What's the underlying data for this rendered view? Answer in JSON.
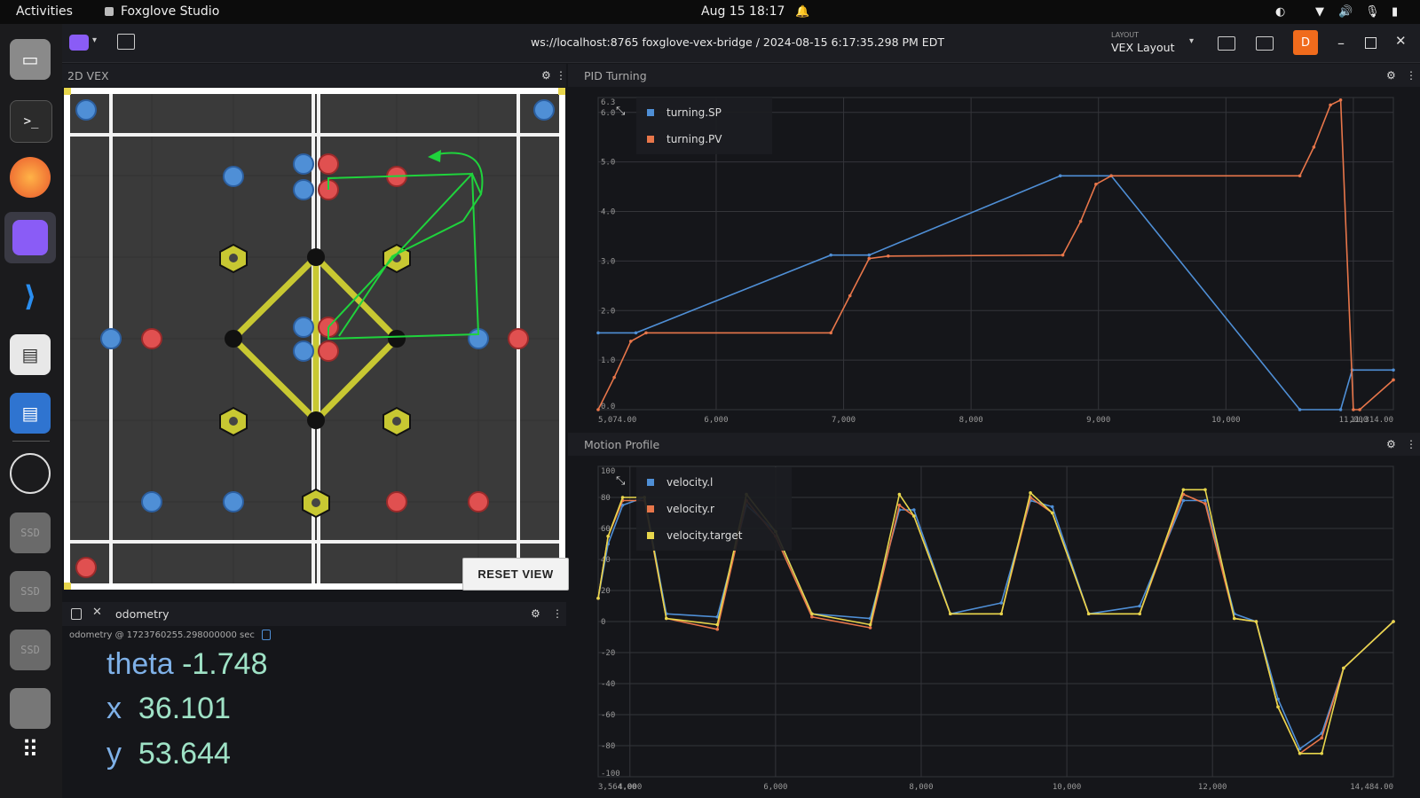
{
  "topbar": {
    "activities": "Activities",
    "app_name": "Foxglove Studio",
    "datetime": "Aug 15  18:17"
  },
  "toolbar": {
    "connection": "ws://localhost:8765 foxglove-vex-bridge / 2024-08-15 6:17:35.298 PM EDT",
    "layout_caption": "LAYOUT",
    "layout_name": "VEX Layout",
    "user_initial": "D"
  },
  "dock": {
    "ssd_label": "SSD"
  },
  "panels": {
    "map": {
      "title": "2D VEX",
      "reset_label": "RESET VIEW"
    },
    "odometry": {
      "tab_label": "odometry",
      "message_meta": "odometry @ 1723760255.298000000 sec",
      "fields": [
        {
          "key": "theta",
          "value": "-1.748"
        },
        {
          "key": "x",
          "value": "36.101"
        },
        {
          "key": "y",
          "value": "53.644"
        }
      ]
    },
    "pid": {
      "title": "PID Turning"
    },
    "motion": {
      "title": "Motion Profile"
    }
  },
  "colors": {
    "blue": "#4f8fd6",
    "orange": "#e8764a",
    "yellow": "#e7d64c",
    "green": "#1fd33c",
    "field_yellow": "#c8c832"
  },
  "chart_data": [
    {
      "type": "line",
      "title": "PID Turning",
      "xlim": [
        5074,
        11314
      ],
      "ylim": [
        0,
        6.3
      ],
      "x_ticks": [
        "5,074.00",
        "6,000",
        "7,000",
        "8,000",
        "9,000",
        "10,000",
        "11,000",
        "11,314.00"
      ],
      "y_ticks": [
        "0.0",
        "1.0",
        "2.0",
        "3.0",
        "4.0",
        "5.0",
        "6.0",
        "6.3"
      ],
      "series": [
        {
          "name": "turning.SP",
          "color": "#4f8fd6",
          "points": [
            [
              5074,
              1.55
            ],
            [
              5370,
              1.55
            ],
            [
              6900,
              3.12
            ],
            [
              7200,
              3.12
            ],
            [
              8700,
              4.72
            ],
            [
              9100,
              4.72
            ],
            [
              10580,
              0
            ],
            [
              10900,
              0
            ],
            [
              10990,
              0.8
            ],
            [
              11314,
              0.8
            ]
          ]
        },
        {
          "name": "turning.PV",
          "color": "#e8764a",
          "points": [
            [
              5074,
              0
            ],
            [
              5200,
              0.65
            ],
            [
              5330,
              1.38
            ],
            [
              5450,
              1.55
            ],
            [
              6900,
              1.55
            ],
            [
              7050,
              2.3
            ],
            [
              7200,
              3.05
            ],
            [
              7350,
              3.1
            ],
            [
              8720,
              3.12
            ],
            [
              8860,
              3.8
            ],
            [
              8980,
              4.55
            ],
            [
              9100,
              4.72
            ],
            [
              10580,
              4.72
            ],
            [
              10690,
              5.3
            ],
            [
              10820,
              6.15
            ],
            [
              10900,
              6.25
            ],
            [
              11000,
              0
            ],
            [
              11050,
              0
            ],
            [
              11314,
              0.6
            ]
          ]
        }
      ]
    },
    {
      "type": "line",
      "title": "Motion Profile",
      "xlim": [
        3564,
        14484
      ],
      "ylim": [
        -100,
        100
      ],
      "x_ticks": [
        "3,564.00",
        "4,000",
        "6,000",
        "8,000",
        "10,000",
        "12,000",
        "14,484.00"
      ],
      "y_ticks": [
        "100",
        "80",
        "60",
        "40",
        "20",
        "0",
        "-20",
        "-40",
        "-60",
        "-80",
        "-100"
      ],
      "series": [
        {
          "name": "velocity.l",
          "color": "#4f8fd6",
          "points": [
            [
              3564,
              15
            ],
            [
              3700,
              50
            ],
            [
              3900,
              75
            ],
            [
              4200,
              80
            ],
            [
              4500,
              5
            ],
            [
              5200,
              3
            ],
            [
              5600,
              75
            ],
            [
              6000,
              58
            ],
            [
              6500,
              5
            ],
            [
              7300,
              2
            ],
            [
              7700,
              72
            ],
            [
              7900,
              72
            ],
            [
              8400,
              5
            ],
            [
              9100,
              12
            ],
            [
              9500,
              78
            ],
            [
              9800,
              74
            ],
            [
              10300,
              5
            ],
            [
              11000,
              10
            ],
            [
              11600,
              78
            ],
            [
              11900,
              78
            ],
            [
              12300,
              5
            ],
            [
              12600,
              0
            ],
            [
              12900,
              -50
            ],
            [
              13200,
              -82
            ],
            [
              13500,
              -72
            ],
            [
              13800,
              -30
            ],
            [
              14484,
              0
            ]
          ]
        },
        {
          "name": "velocity.r",
          "color": "#e8764a",
          "points": [
            [
              3564,
              15
            ],
            [
              3700,
              55
            ],
            [
              3900,
              78
            ],
            [
              4200,
              78
            ],
            [
              4500,
              2
            ],
            [
              5200,
              -5
            ],
            [
              5600,
              78
            ],
            [
              6000,
              55
            ],
            [
              6500,
              3
            ],
            [
              7300,
              -4
            ],
            [
              7700,
              75
            ],
            [
              7900,
              68
            ],
            [
              8400,
              5
            ],
            [
              9100,
              5
            ],
            [
              9500,
              80
            ],
            [
              9800,
              70
            ],
            [
              10300,
              5
            ],
            [
              11000,
              5
            ],
            [
              11600,
              82
            ],
            [
              11900,
              76
            ],
            [
              12300,
              2
            ],
            [
              12600,
              0
            ],
            [
              12900,
              -55
            ],
            [
              13200,
              -85
            ],
            [
              13500,
              -75
            ],
            [
              13800,
              -30
            ],
            [
              14484,
              0
            ]
          ]
        },
        {
          "name": "velocity.target",
          "color": "#e7d64c",
          "points": [
            [
              3564,
              15
            ],
            [
              3700,
              55
            ],
            [
              3900,
              80
            ],
            [
              4200,
              80
            ],
            [
              4500,
              2
            ],
            [
              5200,
              -2
            ],
            [
              5600,
              82
            ],
            [
              6000,
              58
            ],
            [
              6500,
              5
            ],
            [
              7300,
              -2
            ],
            [
              7700,
              82
            ],
            [
              7900,
              68
            ],
            [
              8400,
              5
            ],
            [
              9100,
              5
            ],
            [
              9500,
              83
            ],
            [
              9800,
              70
            ],
            [
              10300,
              5
            ],
            [
              11000,
              5
            ],
            [
              11600,
              85
            ],
            [
              11900,
              85
            ],
            [
              12300,
              2
            ],
            [
              12600,
              0
            ],
            [
              12900,
              -55
            ],
            [
              13200,
              -85
            ],
            [
              13500,
              -85
            ],
            [
              13800,
              -30
            ],
            [
              14484,
              0
            ]
          ]
        }
      ]
    }
  ]
}
